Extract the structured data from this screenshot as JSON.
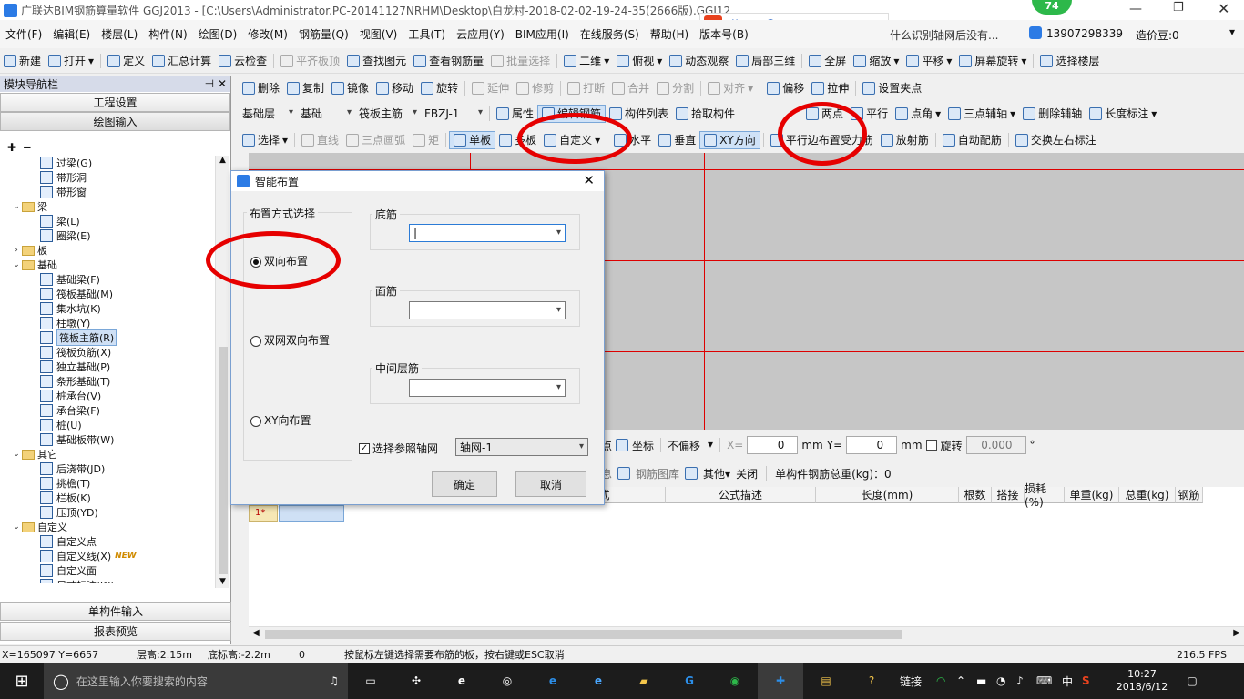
{
  "title": "广联达BIM钢筋算量软件 GGJ2013 - [C:\\Users\\Administrator.PC-20141127NRHM\\Desktop\\白龙村-2018-02-02-19-24-35(2666版).GGJ12]",
  "overlay": {
    "ime_label": "英",
    "badge": "74",
    "wifi_count": "0",
    "notice": "什么识别轴网后没有..."
  },
  "menu": [
    "文件(F)",
    "编辑(E)",
    "楼层(L)",
    "构件(N)",
    "绘图(D)",
    "修改(M)",
    "钢筋量(Q)",
    "视图(V)",
    "工具(T)",
    "云应用(Y)",
    "BIM应用(I)",
    "在线服务(S)",
    "帮助(H)",
    "版本号(B)"
  ],
  "account": {
    "phone": "13907298339",
    "label": "造价豆:0"
  },
  "toolbar1": [
    "新建",
    "打开",
    "定义",
    "汇总计算",
    "云检查",
    "平齐板顶",
    "查找图元",
    "查看钢筋量",
    "批量选择",
    "二维",
    "俯视",
    "动态观察",
    "局部三维",
    "全屏",
    "缩放",
    "平移",
    "屏幕旋转",
    "选择楼层"
  ],
  "toolbar2": [
    "删除",
    "复制",
    "镜像",
    "移动",
    "旋转",
    "延伸",
    "修剪",
    "打断",
    "合并",
    "分割",
    "对齐",
    "偏移",
    "拉伸",
    "设置夹点"
  ],
  "toolbar3": {
    "floor": "基础层",
    "type": "基础",
    "member": "筏板主筋",
    "id": "FBZJ-1",
    "items": [
      "属性",
      "编辑钢筋",
      "构件列表",
      "拾取构件"
    ],
    "right": [
      "两点",
      "平行",
      "点角",
      "三点辅轴",
      "删除辅轴",
      "长度标注"
    ]
  },
  "toolbar4": [
    "选择",
    "直线",
    "三点画弧",
    "矩",
    "单板",
    "多板",
    "自定义",
    "水平",
    "垂直",
    "XY方向",
    "平行边布置受力筋",
    "放射筋",
    "自动配筋",
    "交换左右标注"
  ],
  "nav": {
    "title": "模块导航栏",
    "buttons": [
      "工程设置",
      "绘图输入"
    ],
    "bottom": [
      "单构件输入",
      "报表预览"
    ],
    "tree": [
      {
        "level": 2,
        "label": "过梁(G)"
      },
      {
        "level": 2,
        "label": "带形洞"
      },
      {
        "level": 2,
        "label": "带形窗"
      },
      {
        "level": 1,
        "label": "梁",
        "folder": true,
        "open": true
      },
      {
        "level": 2,
        "label": "梁(L)"
      },
      {
        "level": 2,
        "label": "圈梁(E)"
      },
      {
        "level": 1,
        "label": "板",
        "folder": true,
        "open": false
      },
      {
        "level": 1,
        "label": "基础",
        "folder": true,
        "open": true
      },
      {
        "level": 2,
        "label": "基础梁(F)"
      },
      {
        "level": 2,
        "label": "筏板基础(M)"
      },
      {
        "level": 2,
        "label": "集水坑(K)"
      },
      {
        "level": 2,
        "label": "柱墩(Y)"
      },
      {
        "level": 2,
        "label": "筏板主筋(R)",
        "selected": true
      },
      {
        "level": 2,
        "label": "筏板负筋(X)"
      },
      {
        "level": 2,
        "label": "独立基础(P)"
      },
      {
        "level": 2,
        "label": "条形基础(T)"
      },
      {
        "level": 2,
        "label": "桩承台(V)"
      },
      {
        "level": 2,
        "label": "承台梁(F)"
      },
      {
        "level": 2,
        "label": "桩(U)"
      },
      {
        "level": 2,
        "label": "基础板带(W)"
      },
      {
        "level": 1,
        "label": "其它",
        "folder": true,
        "open": true
      },
      {
        "level": 2,
        "label": "后浇带(JD)"
      },
      {
        "level": 2,
        "label": "挑檐(T)"
      },
      {
        "level": 2,
        "label": "栏板(K)"
      },
      {
        "level": 2,
        "label": "压顶(YD)"
      },
      {
        "level": 1,
        "label": "自定义",
        "folder": true,
        "open": true
      },
      {
        "level": 2,
        "label": "自定义点"
      },
      {
        "level": 2,
        "label": "自定义线(X)",
        "new": "NEW"
      },
      {
        "level": 2,
        "label": "自定义面"
      },
      {
        "level": 2,
        "label": "尺寸标注(W)"
      }
    ]
  },
  "dialog": {
    "title": "智能布置",
    "group_mode": "布置方式选择",
    "options": [
      "双向布置",
      "双网双向布置",
      "XY向布置"
    ],
    "selected": 0,
    "bottom_bar": "底筋",
    "top_bar": "面筋",
    "middle_bar": "中间层筋",
    "bottom_value": "|",
    "checkbox": "选择参照轴网",
    "axis": "轴网-1",
    "ok": "确定",
    "cancel": "取消"
  },
  "coordbar": {
    "snap": "点",
    "coord": "坐标",
    "offset": "不偏移",
    "x_label": "X=",
    "x": "0",
    "y_label": "Y=",
    "y": "0",
    "unit": "mm",
    "rotate": "旋转",
    "angle": "0.000",
    "deg": "°"
  },
  "rebarbar": {
    "info": "息",
    "lib": "钢筋图库",
    "other": "其他",
    "close": "关闭",
    "total": "单构件钢筋总重(kg)：0"
  },
  "grid": {
    "columns": [
      "计算公式",
      "公式描述",
      "长度(mm)",
      "根数",
      "搭接",
      "损耗(%)",
      "单重(kg)",
      "总重(kg)",
      "钢筋"
    ],
    "row_marker": "1*"
  },
  "status": {
    "coords": "X=165097 Y=6657",
    "floor_h": "层高:2.15m",
    "base_h": "底标高:-2.2m",
    "zero": "0",
    "hint": "按鼠标左键选择需要布筋的板，按右键或ESC取消",
    "fps": "216.5 FPS"
  },
  "taskbar": {
    "search": "在这里输入你要搜索的内容",
    "link": "链接",
    "lang": "中",
    "time": "10:27",
    "date": "2018/6/12"
  }
}
